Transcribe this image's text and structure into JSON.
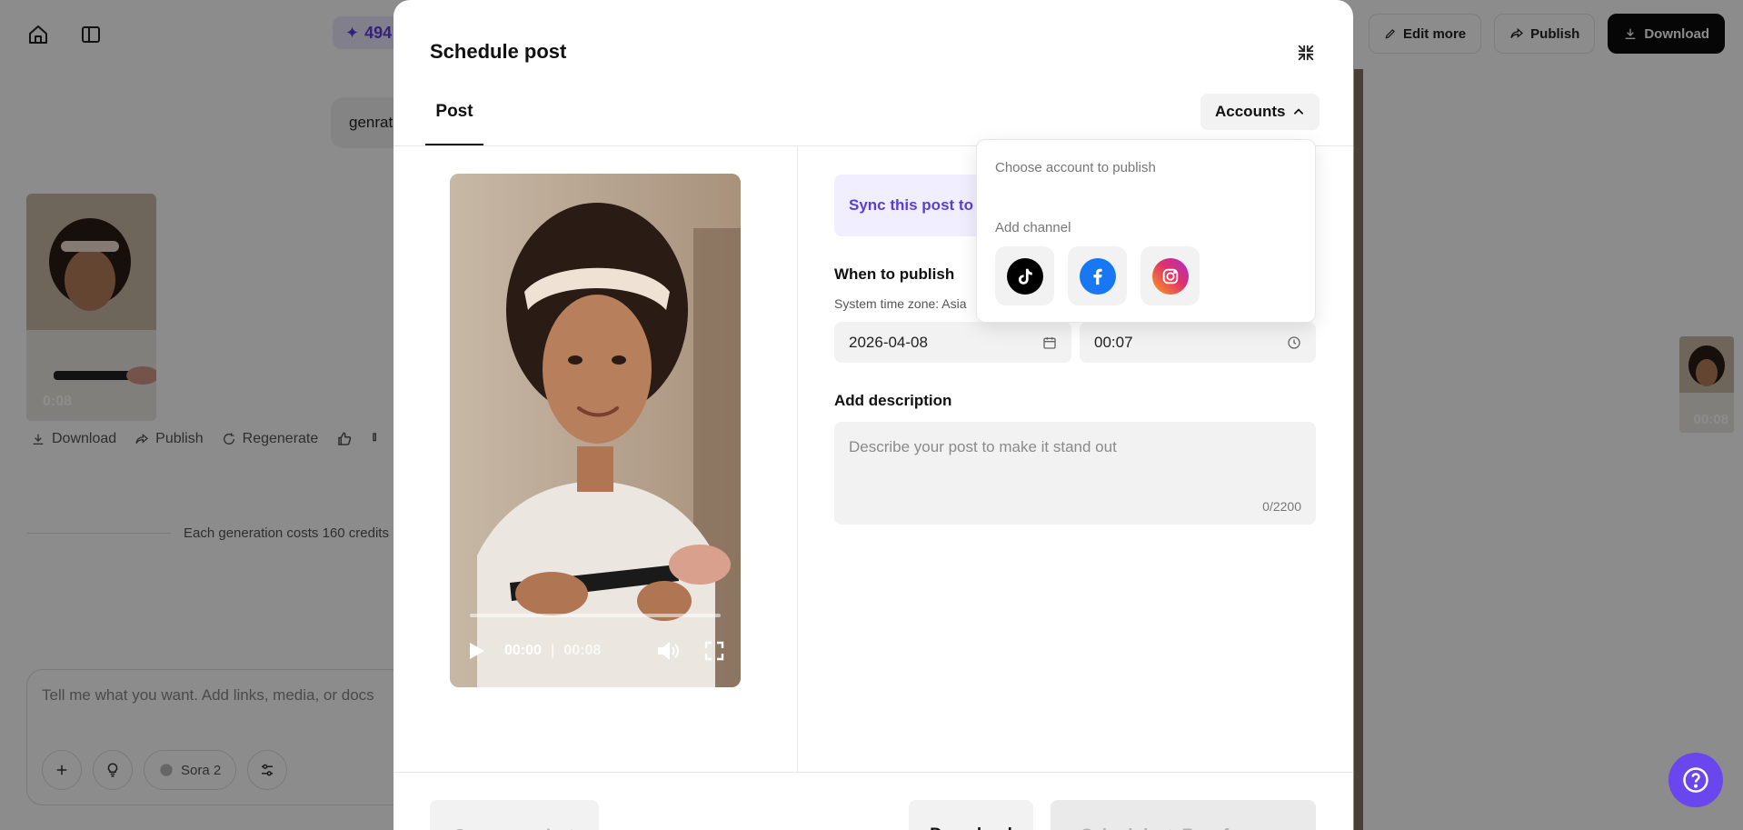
{
  "background": {
    "credits": "494",
    "top_actions": {
      "edit_more": "Edit more",
      "publish": "Publish",
      "download": "Download"
    },
    "prompt_bubble": "genrat",
    "thumbnail": {
      "duration": "0:08"
    },
    "thumb_actions": {
      "download": "Download",
      "publish": "Publish",
      "regenerate": "Regenerate"
    },
    "cost_text": "Each generation costs 160 credits",
    "composer": {
      "placeholder": "Tell me what you want. Add links, media, or docs",
      "model": "Sora 2"
    },
    "mini_thumbnail": {
      "duration": "00:08"
    }
  },
  "modal": {
    "title": "Schedule post",
    "tab_post": "Post",
    "accounts_label": "Accounts",
    "video": {
      "current_time": "00:00",
      "total_time": "00:08",
      "progress": 0
    },
    "sync_text": "Sync this post to",
    "when_title": "When to publish",
    "timezone": "System time zone: Asia",
    "date_value": "2026-04-08",
    "time_value": "00:07",
    "description_title": "Add description",
    "description_placeholder": "Describe your post to make it stand out",
    "char_count": "0/2200",
    "footer": {
      "save": "Save as project",
      "download": "Download",
      "schedule": "Schedule ✦ Free for now"
    }
  },
  "accounts_dropdown": {
    "header": "Choose account to publish",
    "add_channel": "Add channel",
    "channels": [
      {
        "icon": "tiktok-icon",
        "color": "#000000"
      },
      {
        "icon": "facebook-icon",
        "color": "#1877f2"
      },
      {
        "icon": "instagram-icon",
        "color": "#e1306c"
      }
    ]
  },
  "colors": {
    "accent": "#6a46ee",
    "sync_text": "#5a3fd6",
    "overlay": "rgba(0,0,0,0.45)"
  }
}
